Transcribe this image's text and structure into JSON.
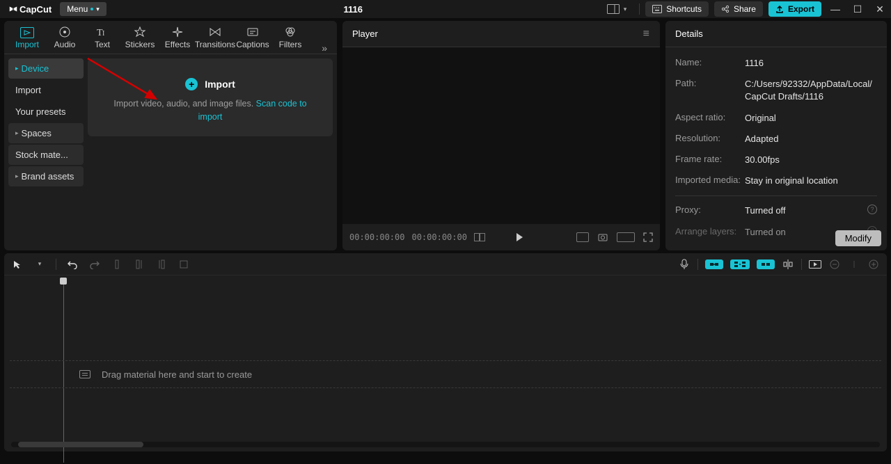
{
  "app": {
    "name": "CapCut",
    "menu_label": "Menu"
  },
  "project": {
    "title": "1116"
  },
  "titlebar_buttons": {
    "shortcuts": "Shortcuts",
    "share": "Share",
    "export": "Export"
  },
  "tabs": [
    {
      "label": "Import",
      "active": true
    },
    {
      "label": "Audio"
    },
    {
      "label": "Text"
    },
    {
      "label": "Stickers"
    },
    {
      "label": "Effects"
    },
    {
      "label": "Transitions"
    },
    {
      "label": "Captions"
    },
    {
      "label": "Filters"
    }
  ],
  "sidebar": {
    "items": [
      {
        "label": "Device",
        "active": true,
        "expandable": true
      },
      {
        "label": "Import"
      },
      {
        "label": "Your presets"
      },
      {
        "label": "Spaces",
        "expandable": true,
        "bg": true
      },
      {
        "label": "Stock mate...",
        "bg": true
      },
      {
        "label": "Brand assets",
        "expandable": true,
        "bg": true
      }
    ]
  },
  "import_box": {
    "title": "Import",
    "desc_pre": "Import video, audio, and image files. ",
    "scan_link": "Scan code to import"
  },
  "player": {
    "title": "Player",
    "time_current": "00:00:00:00",
    "time_total": "00:00:00:00"
  },
  "details": {
    "title": "Details",
    "rows": {
      "name": {
        "label": "Name:",
        "value": "1116"
      },
      "path": {
        "label": "Path:",
        "value": "C:/Users/92332/AppData/Local/CapCut Drafts/1116"
      },
      "aspect": {
        "label": "Aspect ratio:",
        "value": "Original"
      },
      "resolution": {
        "label": "Resolution:",
        "value": "Adapted"
      },
      "framerate": {
        "label": "Frame rate:",
        "value": "30.00fps"
      },
      "imported": {
        "label": "Imported media:",
        "value": "Stay in original location"
      },
      "proxy": {
        "label": "Proxy:",
        "value": "Turned off"
      },
      "arrange": {
        "label": "Arrange layers:",
        "value": "Turned on"
      }
    },
    "modify_label": "Modify"
  },
  "timeline": {
    "placeholder": "Drag material here and start to create"
  }
}
